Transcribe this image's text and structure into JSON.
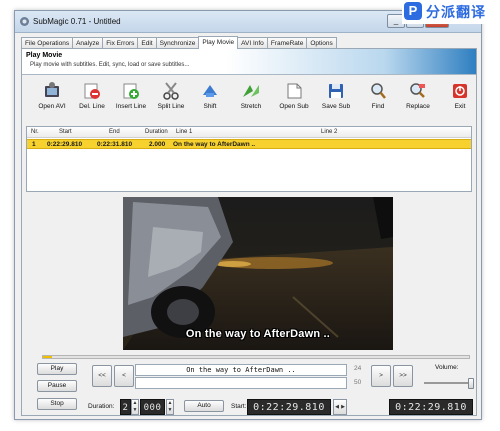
{
  "window": {
    "title": "SubMagic 0.71 - Untitled"
  },
  "logo": {
    "text": "分派翻译"
  },
  "tabs": [
    {
      "label": "File Operations"
    },
    {
      "label": "Analyze"
    },
    {
      "label": "Fix Errors"
    },
    {
      "label": "Edit"
    },
    {
      "label": "Synchronize"
    },
    {
      "label": "Play Movie",
      "active": true
    },
    {
      "label": "AVI Info"
    },
    {
      "label": "FrameRate"
    },
    {
      "label": "Options"
    }
  ],
  "banner": {
    "title": "Play Movie",
    "subtitle": "Play movie with subtitles. Edit, sync, load or save subtitles..."
  },
  "toolbar": [
    {
      "label": "Open AVI",
      "icon": "film-reel-icon"
    },
    {
      "label": "Del. Line",
      "icon": "delete-line-icon"
    },
    {
      "label": "Insert Line",
      "icon": "insert-line-icon"
    },
    {
      "label": "Split Line",
      "icon": "scissors-icon"
    },
    {
      "label": "Shift",
      "icon": "shift-arrows-icon"
    },
    {
      "label": "Stretch",
      "icon": "stretch-arrows-icon"
    },
    {
      "label": "Open Sub",
      "icon": "open-document-icon"
    },
    {
      "label": "Save Sub",
      "icon": "floppy-disk-icon"
    },
    {
      "label": "Find",
      "icon": "magnifier-icon"
    },
    {
      "label": "Replace",
      "icon": "replace-icon"
    },
    {
      "label": "Exit",
      "icon": "exit-icon"
    }
  ],
  "list": {
    "headers": {
      "nr": "Nr.",
      "start": "Start",
      "end": "End",
      "duration": "Duration",
      "line1": "Line 1",
      "line2": "Line 2"
    },
    "rows": [
      {
        "nr": "1",
        "start": "0:22:29.810",
        "end": "0:22:31.810",
        "duration": "2.000",
        "line1": "On the way to AfterDawn ..",
        "line2": ""
      }
    ]
  },
  "video": {
    "subtitle": "On the way to AfterDawn .."
  },
  "progress": {
    "value": 0.02
  },
  "controls": {
    "play": "Play",
    "pause": "Pause",
    "stop": "Stop",
    "prev_fast": "<<",
    "prev": "<",
    "next": ">",
    "next_fast": ">>",
    "line_text": "On the way to AfterDawn ..",
    "count_top": "24",
    "count_bottom": "50",
    "volume_label": "Volume:",
    "volume": 0.95,
    "duration_label": "Duration:",
    "duration_seconds": "2",
    "duration_ms": "000",
    "auto": "Auto",
    "start_label": "Start:",
    "start_time": "0:22:29.810",
    "current_time": "0:22:29.810"
  },
  "colors": {
    "selection": "#f7d22e",
    "progress": "#f0c000"
  }
}
